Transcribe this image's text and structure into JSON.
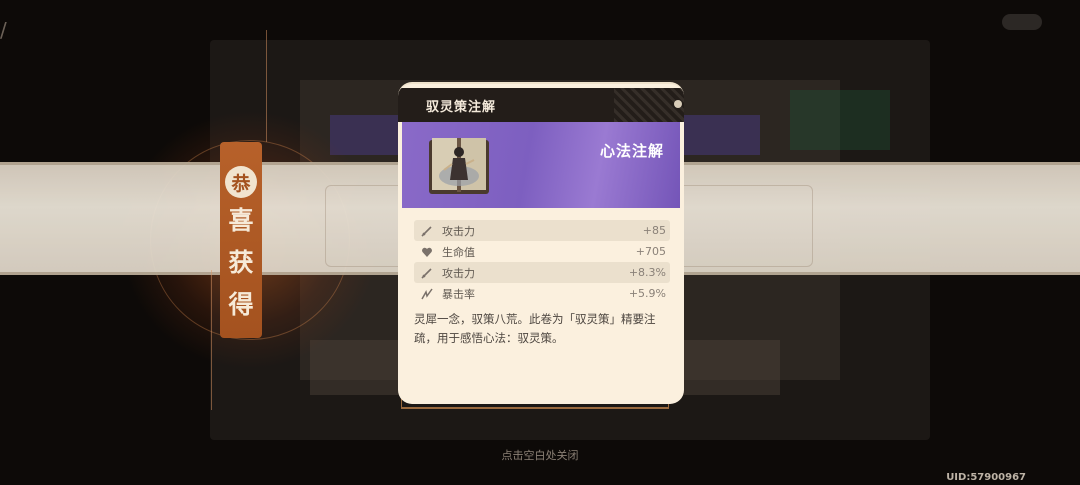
{
  "card": {
    "header_title": "驭灵策注解",
    "item_name": "心法注解",
    "stats": [
      {
        "icon": "sword-icon",
        "label": "攻击力",
        "value": "+85",
        "shaded": true
      },
      {
        "icon": "heart-icon",
        "label": "生命值",
        "value": "+705",
        "shaded": false
      },
      {
        "icon": "sword-icon",
        "label": "攻击力",
        "value": "+8.3%",
        "shaded": true
      },
      {
        "icon": "crit-icon",
        "label": "暴击率",
        "value": "+5.9%",
        "shaded": false
      }
    ],
    "description": "灵犀一念，驭策八荒。此卷为「驭灵策」精要注疏，用于感悟心法：驭灵策。"
  },
  "ribbon": {
    "circle_char": "恭",
    "chars": [
      "喜",
      "获",
      "得"
    ]
  },
  "footer": {
    "close_hint": "点击空白处关闭",
    "uid": "UID:57900967"
  }
}
